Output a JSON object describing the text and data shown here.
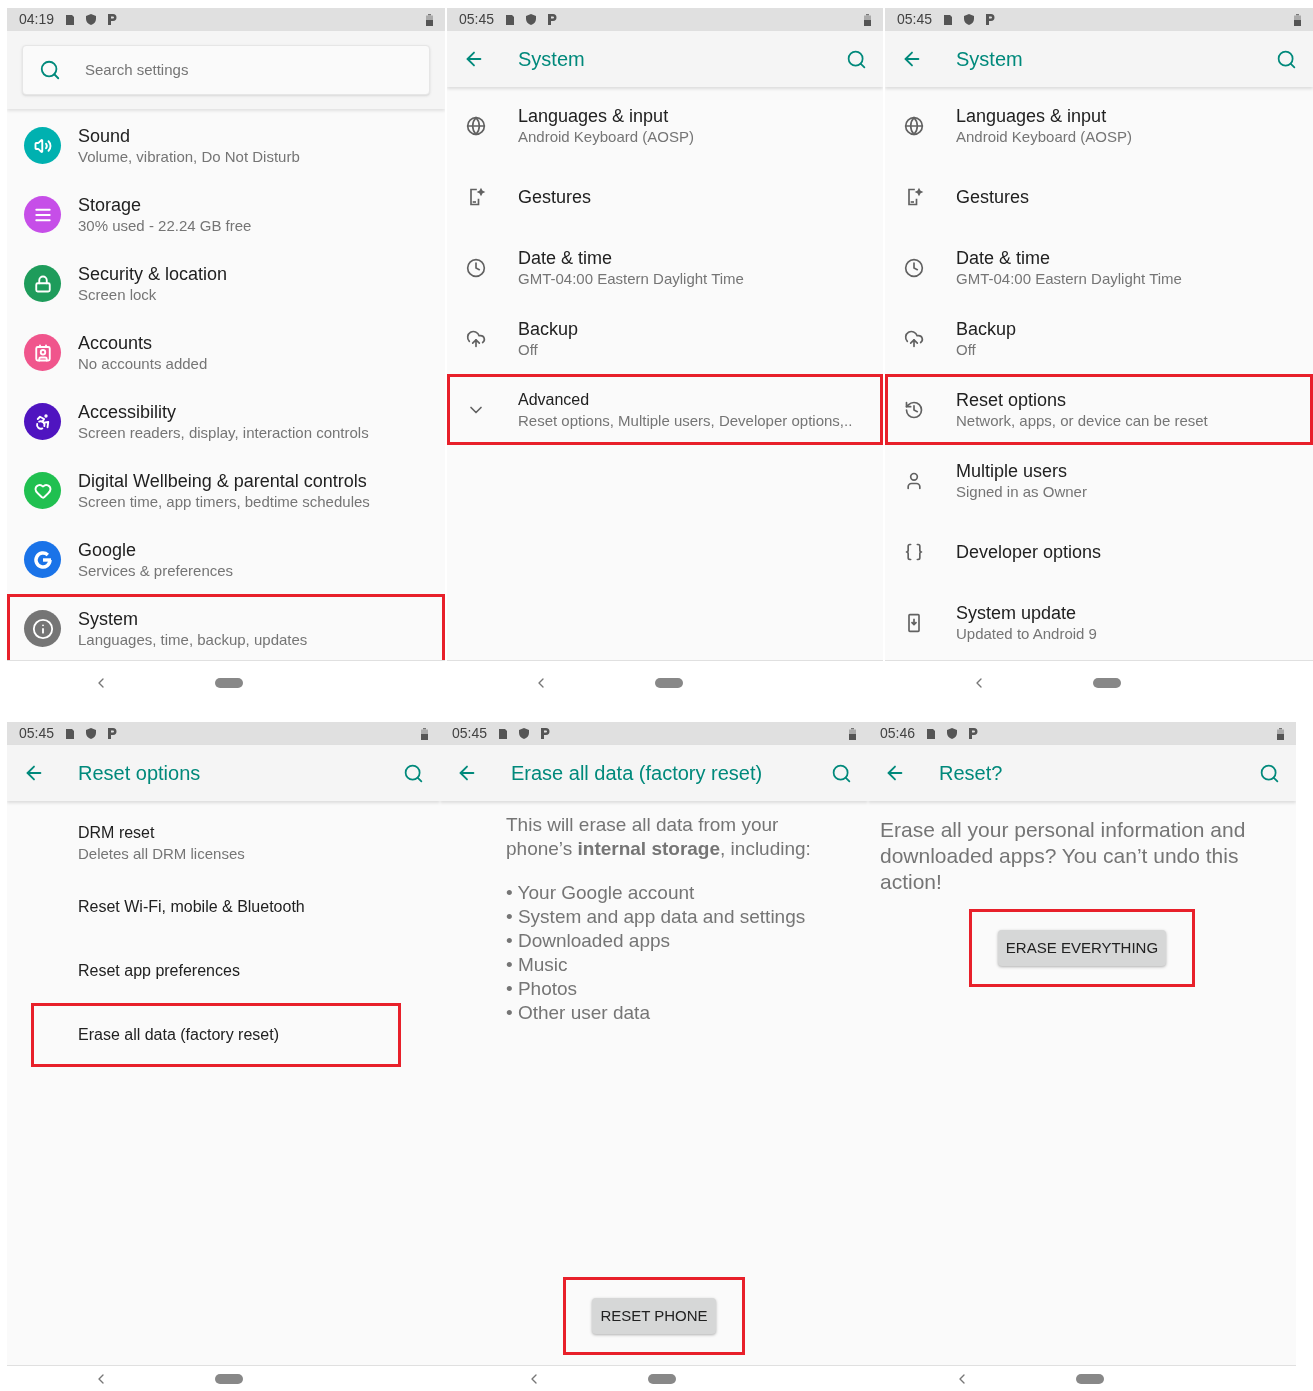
{
  "screens": [
    {
      "kind": "home",
      "status": {
        "time": "04:19"
      },
      "search": {
        "placeholder": "Search settings"
      },
      "items": [
        {
          "title": "Sound",
          "subtitle": "Volume, vibration, Do Not Disturb",
          "color": "#00b1b0",
          "highlighted": false
        },
        {
          "title": "Storage",
          "subtitle": "30% used - 22.24 GB free",
          "color": "#c64ee8",
          "highlighted": false
        },
        {
          "title": "Security & location",
          "subtitle": "Screen lock",
          "color": "#1e9c5b",
          "highlighted": false
        },
        {
          "title": "Accounts",
          "subtitle": "No accounts added",
          "color": "#f0558c",
          "highlighted": false
        },
        {
          "title": "Accessibility",
          "subtitle": "Screen readers, display, interaction controls",
          "color": "#4f14c0",
          "highlighted": false
        },
        {
          "title": "Digital Wellbeing & parental controls",
          "subtitle": "Screen time, app timers, bedtime schedules",
          "color": "#20c050",
          "highlighted": false
        },
        {
          "title": "Google",
          "subtitle": "Services & preferences",
          "color": "#1a73e8",
          "highlighted": false
        },
        {
          "title": "System",
          "subtitle": "Languages, time, backup, updates",
          "color": "#757575",
          "highlighted": true
        }
      ]
    },
    {
      "kind": "list",
      "status": {
        "time": "05:45"
      },
      "title": "System",
      "items": [
        {
          "title": "Languages & input",
          "subtitle": "Android Keyboard (AOSP)",
          "highlighted": false
        },
        {
          "title": "Gestures",
          "highlighted": false
        },
        {
          "title": "Date & time",
          "subtitle": "GMT-04:00 Eastern Daylight Time",
          "highlighted": false
        },
        {
          "title": "Backup",
          "subtitle": "Off",
          "highlighted": false
        },
        {
          "title": "Advanced",
          "subtitle": "Reset options, Multiple users, Developer options,..",
          "highlighted": true,
          "expandable": true
        }
      ]
    },
    {
      "kind": "list",
      "status": {
        "time": "05:45"
      },
      "title": "System",
      "items": [
        {
          "title": "Languages & input",
          "subtitle": "Android Keyboard (AOSP)",
          "highlighted": false
        },
        {
          "title": "Gestures",
          "highlighted": false
        },
        {
          "title": "Date & time",
          "subtitle": "GMT-04:00 Eastern Daylight Time",
          "highlighted": false
        },
        {
          "title": "Backup",
          "subtitle": "Off",
          "highlighted": false
        },
        {
          "title": "Reset options",
          "subtitle": "Network, apps, or device can be reset",
          "highlighted": true
        },
        {
          "title": "Multiple users",
          "subtitle": "Signed in as Owner",
          "highlighted": false
        },
        {
          "title": "Developer options",
          "highlighted": false
        },
        {
          "title": "System update",
          "subtitle": "Updated to Android 9",
          "highlighted": false
        }
      ]
    },
    {
      "kind": "plain_list",
      "status": {
        "time": "05:45"
      },
      "title": "Reset options",
      "items": [
        {
          "title": "DRM reset",
          "subtitle": "Deletes all DRM licenses",
          "highlighted": false
        },
        {
          "title": "Reset Wi-Fi, mobile & Bluetooth",
          "highlighted": false
        },
        {
          "title": "Reset app preferences",
          "highlighted": false
        },
        {
          "title": "Erase all data (factory reset)",
          "highlighted": true
        }
      ]
    },
    {
      "kind": "info",
      "status": {
        "time": "05:45"
      },
      "title": "Erase all data (factory reset)",
      "message": "This will erase all data from your phone’s **internal storage**, including:",
      "bullets": [
        "• Your Google account",
        "• System and app data and settings",
        "• Downloaded apps",
        "• Music",
        "• Photos",
        "• Other user data"
      ],
      "button": {
        "label": "RESET PHONE",
        "highlighted": true
      }
    },
    {
      "kind": "confirm",
      "status": {
        "time": "05:46"
      },
      "title": "Reset?",
      "message": "Erase all your personal information and downloaded apps? You can’t undo this action!",
      "button": {
        "label": "ERASE EVERYTHING",
        "highlighted": true
      }
    }
  ]
}
